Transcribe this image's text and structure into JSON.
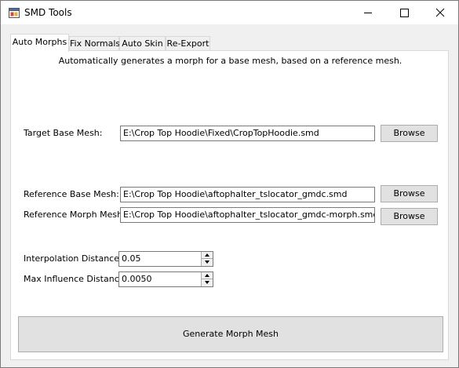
{
  "window": {
    "title": "SMD Tools",
    "icons": [
      "app-icon",
      "minimize-icon",
      "maximize-icon",
      "close-icon"
    ]
  },
  "tabs": [
    {
      "label": "Auto Morphs",
      "active": true
    },
    {
      "label": "Fix Normals",
      "active": false
    },
    {
      "label": "Auto Skin",
      "active": false
    },
    {
      "label": "Re-Export",
      "active": false
    }
  ],
  "auto_morphs": {
    "description": "Automatically generates a morph for a base mesh, based on a reference mesh.",
    "target_base": {
      "label": "Target Base Mesh:",
      "value": "E:\\Crop Top Hoodie\\Fixed\\CropTopHoodie.smd",
      "button": "Browse"
    },
    "reference_base": {
      "label": "Reference Base Mesh:",
      "value": "E:\\Crop Top Hoodie\\aftophalter_tslocator_gmdc.smd",
      "button": "Browse"
    },
    "reference_morph": {
      "label": "Reference Morph Mesh:",
      "value": "E:\\Crop Top Hoodie\\aftophalter_tslocator_gmdc-morph.smd",
      "button": "Browse"
    },
    "interpolation": {
      "label": "Interpolation Distance:",
      "value": "0.05"
    },
    "max_influence": {
      "label": "Max Influence Distance:",
      "value": "0.0050"
    },
    "generate_button": "Generate Morph Mesh"
  },
  "colors": {
    "window_bg": "#f0f0f0",
    "button_bg": "#e1e1e1",
    "button_border": "#adadad",
    "field_border": "#7a7a7a"
  }
}
